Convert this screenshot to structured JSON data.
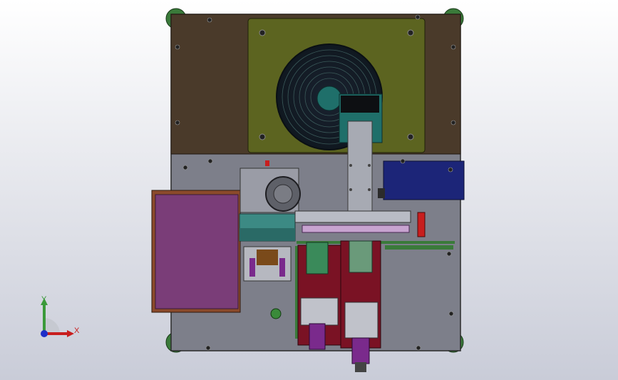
{
  "viewport": {
    "colors": {
      "background_top": "#ffffff",
      "background_bottom": "#c9ccd8",
      "base_plate": "#7d7f8a",
      "base_edge": "#2b2b2b",
      "rear_panel": "#4a3a2a",
      "fan_panel": "#5c6420",
      "fan_guard": "#18202a",
      "hub": "#1f6f6a",
      "side_box": "#7a3d78",
      "blue_box": "#1c2578",
      "red_block": "#7a1224",
      "purple_part": "#7a2a8c",
      "green_corner": "#3a7a3a"
    },
    "icons": [
      "coordinate-triad-icon"
    ]
  },
  "triad": {
    "y_label": "Y",
    "x_label": "X",
    "y_color": "#3a9a3a",
    "x_color": "#c81e1e",
    "z_color": "#1e2ec8"
  }
}
